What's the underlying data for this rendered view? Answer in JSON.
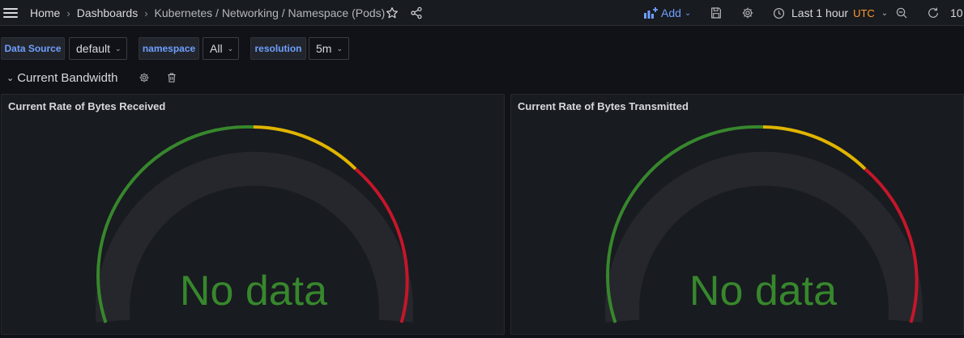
{
  "breadcrumb": {
    "items": [
      "Home",
      "Dashboards",
      "Kubernetes / Networking / Namespace (Pods)"
    ]
  },
  "toolbar": {
    "add_label": "Add",
    "time_range": "Last 1 hour",
    "timezone": "UTC",
    "refresh_partial": "10"
  },
  "variables": [
    {
      "label": "Data Source",
      "value": "default"
    },
    {
      "label": "namespace",
      "value": "All"
    },
    {
      "label": "resolution",
      "value": "5m"
    }
  ],
  "row": {
    "title": "Current Bandwidth"
  },
  "panels": [
    {
      "title": "Current Rate of Bytes Received",
      "value_text": "No data"
    },
    {
      "title": "Current Rate of Bytes Transmitted",
      "value_text": "No data"
    }
  ],
  "colors": {
    "background": "#111217",
    "panel": "#181b1f",
    "accent_blue": "#6e9fff",
    "utc_orange": "#ff9830",
    "threshold_green": "#37872d",
    "threshold_yellow": "#e0b400",
    "threshold_red": "#c4162a",
    "gauge_track": "#25272c"
  },
  "icons": {
    "menu": "hamburger-menu-icon",
    "star": "star-icon",
    "share": "share-icon",
    "add": "add-panel-icon",
    "save": "save-icon",
    "settings": "gear-icon",
    "clock": "clock-icon",
    "zoom_out": "zoom-out-icon",
    "refresh": "refresh-icon",
    "row_settings": "gear-icon",
    "row_delete": "trash-icon"
  }
}
